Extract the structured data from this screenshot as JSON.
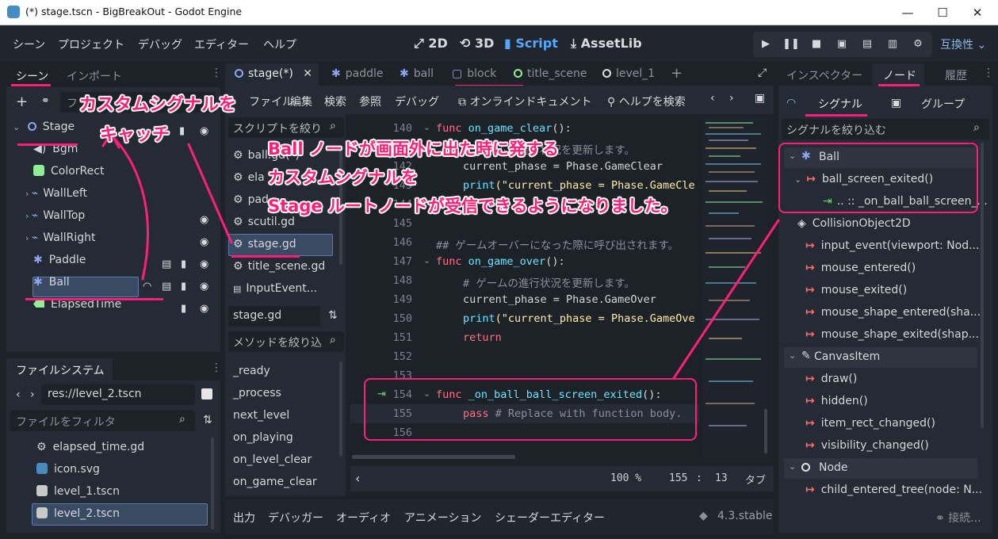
{
  "window": {
    "title": "(*) stage.tscn - BigBreakOut - Godot Engine",
    "minimize": "—",
    "maximize": "☐",
    "close": "✕"
  },
  "menu": {
    "items": [
      "シーン",
      "プロジェクト",
      "デバッグ",
      "エディター",
      "ヘルプ"
    ]
  },
  "modes": {
    "m2d": "2D",
    "m3d": "3D",
    "script": "Script",
    "assetlib": "AssetLib"
  },
  "renderer": "互換性",
  "scene_dock": {
    "tabs": [
      "シーン",
      "インポート"
    ],
    "filter_placeholder": "フ",
    "tree": [
      {
        "name": "Stage",
        "color": "#8da5f3"
      },
      {
        "name": "Bgm",
        "color": "#c0c4ca"
      },
      {
        "name": "ColorRect",
        "color": "#8eef97"
      },
      {
        "name": "WallLeft",
        "color": "#8da5f3"
      },
      {
        "name": "WallTop",
        "color": "#8da5f3"
      },
      {
        "name": "WallRight",
        "color": "#8da5f3"
      },
      {
        "name": "Paddle",
        "color": "#8da5f3"
      },
      {
        "name": "Ball",
        "color": "#8da5f3"
      },
      {
        "name": "ElapsedTime",
        "color": "#8eef97"
      }
    ]
  },
  "filesystem": {
    "tab": "ファイルシステム",
    "path": "res://level_2.tscn",
    "filter_placeholder": "ファイルをフィルタ",
    "files": [
      "elapsed_time.gd",
      "icon.svg",
      "level_1.tscn",
      "level_2.tscn"
    ]
  },
  "script_tabs": [
    "stage(*)",
    "paddle",
    "ball",
    "block",
    "title_scene",
    "level_1"
  ],
  "script_menu": [
    "ファイル",
    "編集",
    "検索",
    "参照",
    "デバッグ"
  ],
  "script_links": {
    "docs": "オンラインドキュメント",
    "help": "ヘルプを検索"
  },
  "script_list": {
    "filter_placeholder": "スクリプトを絞り",
    "items": [
      "ball.gd(*)",
      "ela",
      "pad",
      "scutil.gd",
      "stage.gd",
      "title_scene.gd",
      "InputEvent..."
    ],
    "current": "stage.gd",
    "method_filter_placeholder": "メソッドを絞り込",
    "methods": [
      "_ready",
      "_process",
      "next_level",
      "on_playing",
      "on_level_clear",
      "on_game_clear"
    ]
  },
  "code": {
    "line_numbers": [
      "140",
      "141",
      "142",
      "143",
      "144",
      "145",
      "146",
      "147",
      "148",
      "149",
      "150",
      "151",
      "152",
      "153",
      "154",
      "155",
      "156"
    ],
    "l140_kw": "func",
    "l140_fn": "on_game_clear",
    "l140_rest": "():",
    "l141": "# ゲームの進行状況を更新します。",
    "l142": "current_phase = Phase.GameClear",
    "l143_fn": "print",
    "l143_str": "(\"current_phase = Phase.GameCle",
    "l146": "## ゲームオーバーになった際に呼び出されます。",
    "l147_kw": "func",
    "l147_fn": "on_game_over",
    "l147_rest": "():",
    "l148": "# ゲームの進行状況を更新します。",
    "l149": "current_phase = Phase.GameOver",
    "l150_fn": "print",
    "l150_str": "(\"current_phase = Phase.GameOve",
    "l151": "return",
    "l154_kw": "func",
    "l154_fn": "_on_ball_ball_screen_exited",
    "l154_rest": "():",
    "l155_kw": "pass",
    "l155_cm": "# Replace with function body."
  },
  "status": {
    "zoom": "100 %",
    "line": "155",
    "sep": ":",
    "col": "13",
    "tab": "タブ"
  },
  "bottom_tabs": [
    "出力",
    "デバッガー",
    "オーディオ",
    "アニメーション",
    "シェーダーエディター"
  ],
  "version": "4.3.stable",
  "right_dock": {
    "tabs": [
      "インスペクター",
      "ノード",
      "履歴"
    ],
    "subtabs": {
      "signals": "シグナル",
      "groups": "グループ"
    },
    "filter_placeholder": "シグナルを絞り込む",
    "ball": "Ball",
    "ball_signal": "ball_screen_exited()",
    "connection": ".. :: _on_ball_ball_screen_...",
    "collision": "CollisionObject2D",
    "collision_signals": [
      "input_event(viewport: Nod...",
      "mouse_entered()",
      "mouse_exited()",
      "mouse_shape_entered(sha...",
      "mouse_shape_exited(shap..."
    ],
    "canvas": "CanvasItem",
    "canvas_signals": [
      "draw()",
      "hidden()",
      "item_rect_changed()",
      "visibility_changed()"
    ],
    "node": "Node",
    "node_signals": [
      "child_entered_tree(node: N..."
    ],
    "connect": "接続..."
  },
  "annotations": {
    "catch1": "カスタムシグナルを",
    "catch2": "キャッチ",
    "desc1": "Ball ノードが画面外に出た時に発する",
    "desc2": "カスタムシグナルを",
    "desc3": "Stage ルートノードが受信できるようになりました。"
  },
  "colors": {
    "accent": "#56a8ff",
    "annotation": "#ff1f78"
  }
}
